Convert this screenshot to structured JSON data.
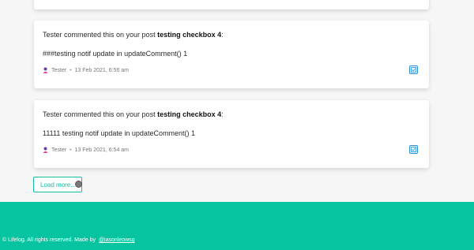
{
  "notifications": [
    {
      "prefix": "Tester commented this on your post ",
      "post_title": "testing checkbox 4",
      "suffix": ":",
      "comment": "###testing notif update in updateComment() 1",
      "author": "Tester",
      "timestamp": "13 Feb 2021, 6:56 am"
    },
    {
      "prefix": "Tester commented this on your post ",
      "post_title": "testing checkbox 4",
      "suffix": ":",
      "comment": "11111 testing notif update in updateComment() 1",
      "author": "Tester",
      "timestamp": "13 Feb 2021, 6:54 am"
    }
  ],
  "separator": "•",
  "load_more_label": "Load more...",
  "footer": {
    "text": "© Lifelog. All rights reserved. Made by ",
    "link": "@jasonleowsg"
  },
  "colors": {
    "accent": "#06c4a0",
    "action_blue": "#2b8fd6"
  }
}
